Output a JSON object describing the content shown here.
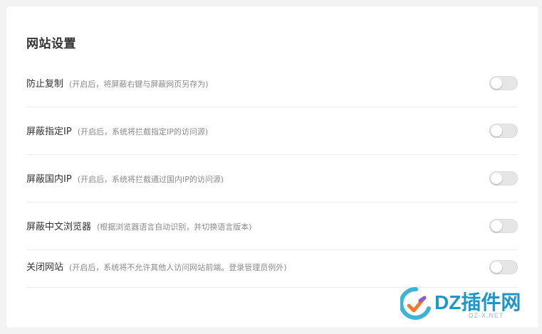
{
  "page_title": "网站设置",
  "settings": [
    {
      "label": "防止复制",
      "hint": "(开启后，将屏蔽右键与屏蔽网页另存为)",
      "enabled": false
    },
    {
      "label": "屏蔽指定IP",
      "hint": "(开启后，系统将拦截指定IP的访问源)",
      "enabled": false
    },
    {
      "label": "屏蔽国内IP",
      "hint": "(开启后，系统将拦截通过国内IP的访问源)",
      "enabled": false
    },
    {
      "label": "屏蔽中文浏览器",
      "hint": "(根据浏览器语言自动识别，并切换语言版本)",
      "enabled": false
    },
    {
      "label": "关闭网站",
      "hint": "(开启后，系统将不允许其他人访问网站前端。登录管理员例外)",
      "enabled": false
    }
  ],
  "watermark": {
    "text": "DZ插件网",
    "sub": "DZ-X.NET"
  },
  "colors": {
    "toggle_off": "#e6e6e6",
    "watermark": "#1f97c6"
  }
}
